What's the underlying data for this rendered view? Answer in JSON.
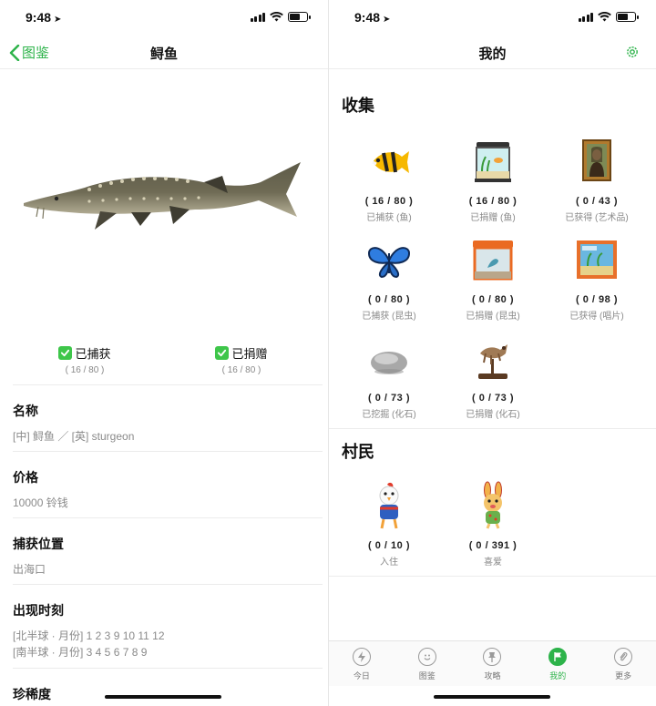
{
  "colors": {
    "accent": "#2db34a",
    "check": "#3ec64a",
    "muted": "#8a8a8a"
  },
  "status": {
    "time": "9:48"
  },
  "left": {
    "nav": {
      "back_label": "图鉴",
      "title": "鲟鱼"
    },
    "caught": {
      "label": "已捕获",
      "count": "( 16 / 80 )"
    },
    "donated": {
      "label": "已捐赠",
      "count": "( 16 / 80 )"
    },
    "sections": [
      {
        "heading": "名称",
        "lines": [
          "[中] 鲟鱼 ／ [英] sturgeon"
        ]
      },
      {
        "heading": "价格",
        "lines": [
          "10000 铃钱"
        ]
      },
      {
        "heading": "捕获位置",
        "lines": [
          "出海口"
        ]
      },
      {
        "heading": "出现时刻",
        "lines": [
          "[北半球 · 月份] 1 2 3 9 10 11 12",
          "[南半球 · 月份] 3 4 5 6 7 8 9"
        ]
      },
      {
        "heading": "珍稀度",
        "lines": []
      }
    ]
  },
  "right": {
    "nav": {
      "title": "我的"
    },
    "collect_title": "收集",
    "collect": [
      {
        "icon": "fish-icon",
        "count": "( 16 / 80 )",
        "label": "已捕获 (鱼)"
      },
      {
        "icon": "aquarium-icon",
        "count": "( 16 / 80 )",
        "label": "已捐赠 (鱼)"
      },
      {
        "icon": "painting-icon",
        "count": "( 0 / 43 )",
        "label": "已获得 (艺术品)"
      },
      {
        "icon": "butterfly-icon",
        "count": "( 0 / 80 )",
        "label": "已捕获 (昆虫)"
      },
      {
        "icon": "insect-case-icon",
        "count": "( 0 / 80 )",
        "label": "已捐赠 (昆虫)"
      },
      {
        "icon": "record-icon",
        "count": "( 0 / 98 )",
        "label": "已获得 (唱片)"
      },
      {
        "icon": "fossil-rock-icon",
        "count": "( 0 / 73 )",
        "label": "已挖掘 (化石)"
      },
      {
        "icon": "fossil-skeleton-icon",
        "count": "( 0 / 73 )",
        "label": "已捐赠 (化石)"
      }
    ],
    "villager_title": "村民",
    "villagers": [
      {
        "icon": "villager-chicken-icon",
        "count": "( 0 / 10 )",
        "label": "入住"
      },
      {
        "icon": "villager-rabbit-icon",
        "count": "( 0 / 391 )",
        "label": "喜爱"
      }
    ],
    "tabs": [
      {
        "icon": "bolt-icon",
        "label": "今日",
        "active": false
      },
      {
        "icon": "smile-icon",
        "label": "图鉴",
        "active": false
      },
      {
        "icon": "pin-icon",
        "label": "攻略",
        "active": false
      },
      {
        "icon": "flag-icon",
        "label": "我的",
        "active": true
      },
      {
        "icon": "paperclip-icon",
        "label": "更多",
        "active": false
      }
    ]
  }
}
